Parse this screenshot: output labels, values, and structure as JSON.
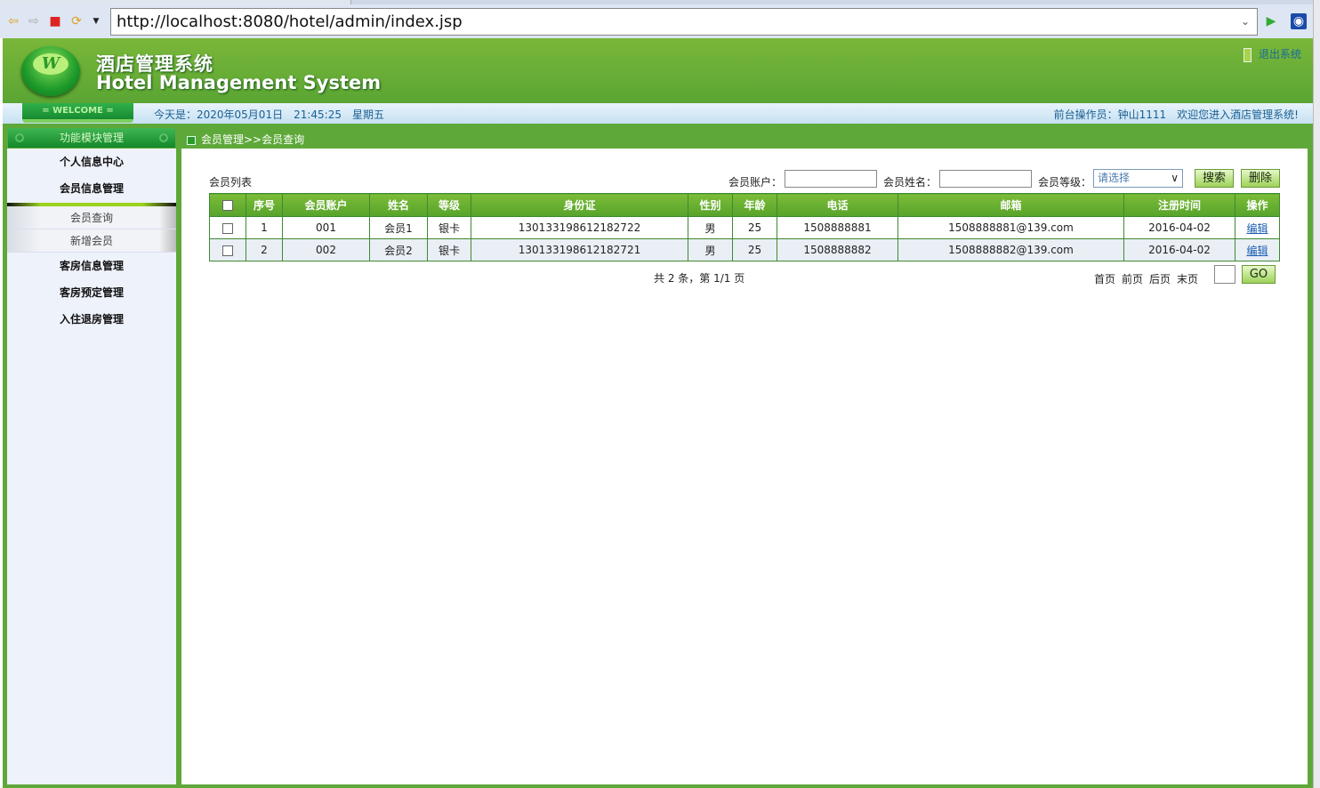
{
  "browser": {
    "url": "http://localhost:8080/hotel/admin/index.jsp",
    "icons": [
      "back-arrow-icon",
      "forward-arrow-icon",
      "stop-icon",
      "refresh-icon",
      "dropdown-icon",
      "go-icon",
      "browser-logo-icon"
    ]
  },
  "header": {
    "title_cn": "酒店管理系统",
    "title_en": "Hotel Management System",
    "logout": "退出系统",
    "logo_letter": "W"
  },
  "welcome": {
    "badge": "= WELCOME =",
    "date": "今天是：2020年05月01日　21:45:25　星期五",
    "operator": "前台操作员：钟山1111　欢迎您进入酒店管理系统!"
  },
  "sidebar": {
    "title": "功能模块管理",
    "items": [
      "个人信息中心",
      "会员信息管理"
    ],
    "subitems": [
      "会员查询",
      "新增会员"
    ],
    "items2": [
      "客房信息管理",
      "客房预定管理",
      "入住退房管理"
    ]
  },
  "breadcrumb": "会员管理>>会员查询",
  "search": {
    "list_label": "会员列表",
    "account_label": "会员账户：",
    "name_label": "会员姓名：",
    "level_label": "会员等级：",
    "level_selected": "请选择",
    "search_btn": "搜索",
    "delete_btn": "删除"
  },
  "table": {
    "headers": [
      "序号",
      "会员账户",
      "姓名",
      "等级",
      "身份证",
      "性别",
      "年龄",
      "电话",
      "邮箱",
      "注册时间",
      "操作"
    ],
    "rows": [
      [
        "1",
        "001",
        "会员1",
        "银卡",
        "130133198612182722",
        "男",
        "25",
        "1508888881",
        "1508888881@139.com",
        "2016-04-02",
        "编辑"
      ],
      [
        "2",
        "002",
        "会员2",
        "银卡",
        "130133198612182721",
        "男",
        "25",
        "1508888882",
        "1508888882@139.com",
        "2016-04-02",
        "编辑"
      ]
    ]
  },
  "pager": {
    "total": "共 2 条，第 1/1 页",
    "first": "首页",
    "prev": "前页",
    "next": "后页",
    "last": "末页",
    "go": "GO"
  }
}
